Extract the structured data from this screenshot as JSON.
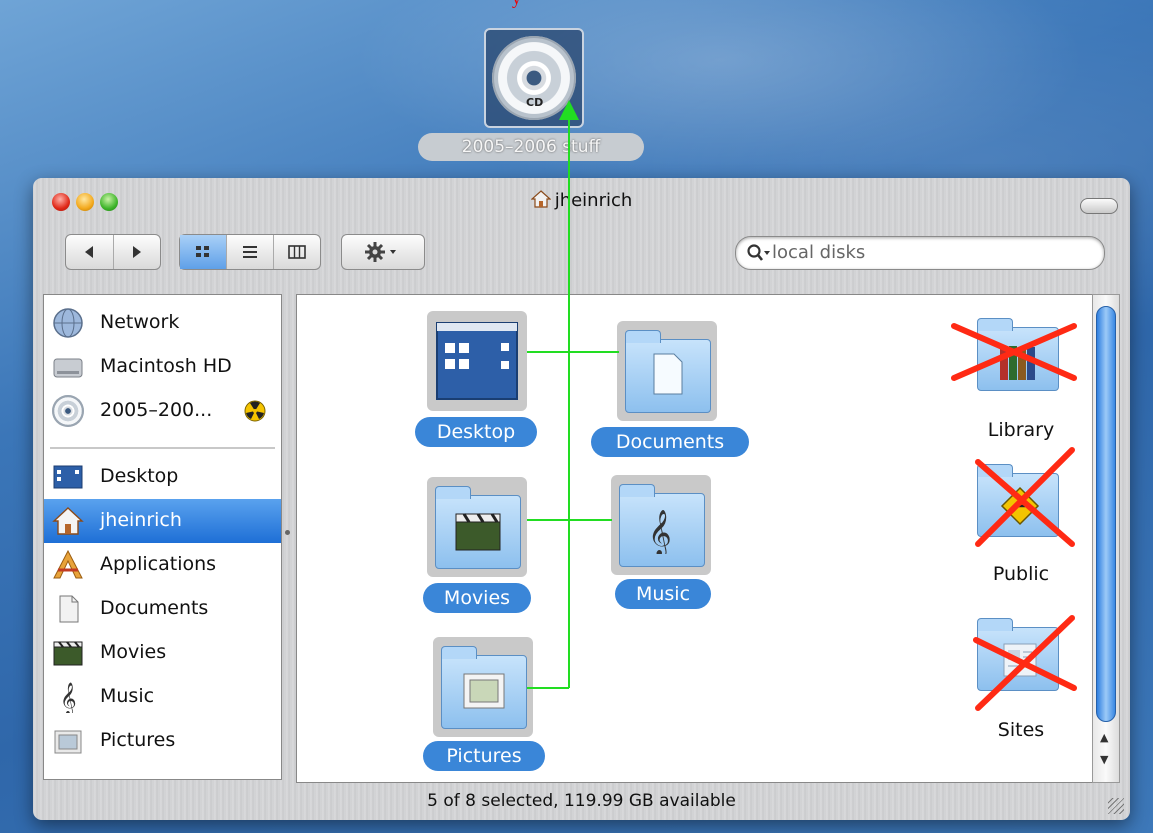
{
  "desktop": {
    "caption_fragment": "y",
    "cd_label": "2005–2006 stuff",
    "cd_icon_text": "CD"
  },
  "window": {
    "title": "jheinrich",
    "search_placeholder": "local disks",
    "status": "5 of 8 selected, 119.99 GB available"
  },
  "sidebar": {
    "items": [
      {
        "label": "Network",
        "icon": "network-icon"
      },
      {
        "label": "Macintosh HD",
        "icon": "hard-disk-icon"
      },
      {
        "label": "2005–200...",
        "icon": "cd-icon"
      },
      {
        "label": "Desktop",
        "icon": "desktop-icon"
      },
      {
        "label": "jheinrich",
        "icon": "home-icon",
        "selected": true
      },
      {
        "label": "Applications",
        "icon": "applications-icon"
      },
      {
        "label": "Documents",
        "icon": "document-icon"
      },
      {
        "label": "Movies",
        "icon": "movies-icon"
      },
      {
        "label": "Music",
        "icon": "music-icon"
      },
      {
        "label": "Pictures",
        "icon": "pictures-icon"
      }
    ]
  },
  "items": {
    "desktop": "Desktop",
    "documents": "Documents",
    "movies": "Movies",
    "music": "Music",
    "pictures": "Pictures",
    "library": "Library",
    "public": "Public",
    "sites": "Sites"
  },
  "colors": {
    "selection": "#3a86d8",
    "annotation_line": "#22dd22",
    "annotation_cross": "#ff2a14"
  }
}
